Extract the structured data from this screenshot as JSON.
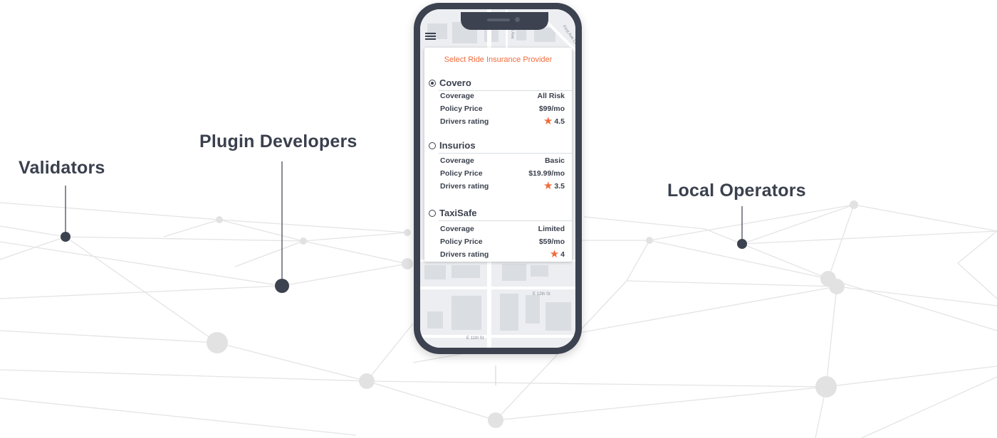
{
  "labels": {
    "validators": "Validators",
    "plugin_developers": "Plugin Developers",
    "local_operators": "Local Operators"
  },
  "map": {
    "streets": [
      "1st Ave",
      "First Ave Loop",
      "E 12th St",
      "E 11th St"
    ]
  },
  "card": {
    "title": "Select Ride Insurance Provider",
    "providers": [
      {
        "name": "Covero",
        "selected": true,
        "coverage_label": "Coverage",
        "coverage": "All Risk",
        "price_label": "Policy Price",
        "price": "$99/mo",
        "rating_label": "Drivers rating",
        "rating": "4.5"
      },
      {
        "name": "Insurios",
        "selected": false,
        "coverage_label": "Coverage",
        "coverage": "Basic",
        "price_label": "Policy Price",
        "price": "$19.99/mo",
        "rating_label": "Drivers rating",
        "rating": "3.5"
      },
      {
        "name": "TaxiSafe",
        "selected": false,
        "coverage_label": "Coverage",
        "coverage": "Limited",
        "price_label": "Policy Price",
        "price": "$59/mo",
        "rating_label": "Drivers rating",
        "rating": "4"
      }
    ]
  },
  "colors": {
    "accent": "#f26b3a",
    "dark": "#3c424f",
    "text": "#3a404d",
    "network": "#e3e3e3"
  },
  "icons": {
    "menu": "hamburger-menu-icon",
    "rating": "star-icon",
    "selection": "radio-icon"
  }
}
